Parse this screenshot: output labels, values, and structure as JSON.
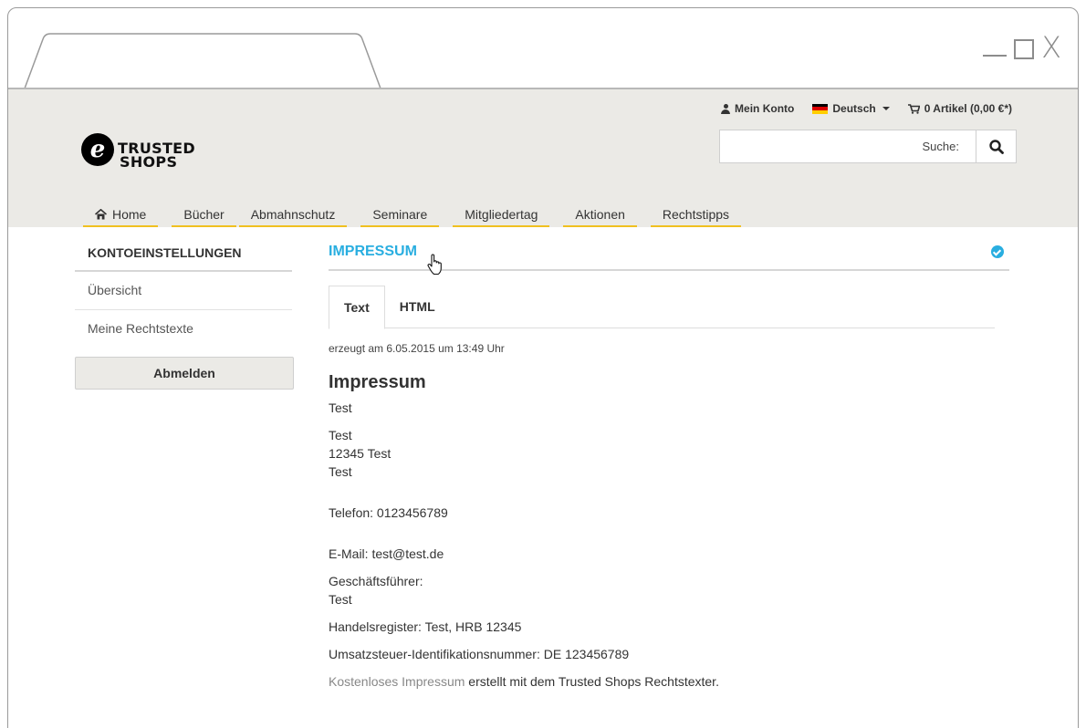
{
  "header": {
    "logo": {
      "mark": "e",
      "line1": "TRUSTED",
      "line2": "SHOPS"
    },
    "topbar": {
      "account": "Mein Konto",
      "language": "Deutsch",
      "cart": "0 Artikel (0,00 €*)"
    },
    "search": {
      "placeholder": "Suche:"
    },
    "nav": [
      "Home",
      "Bücher",
      "Abmahnschutz",
      "Seminare",
      "Mitgliedertag",
      "Aktionen",
      "Rechtstipps"
    ]
  },
  "sidebar": {
    "title": "KONTOEINSTELLUNGEN",
    "links": [
      "Übersicht",
      "Meine Rechtstexte"
    ],
    "logout_label": "Abmelden"
  },
  "main": {
    "title": "IMPRESSUM",
    "tabs": [
      "Text",
      "HTML"
    ],
    "generated": "erzeugt am 6.05.2015 um 13:49 Uhr",
    "content": {
      "heading": "Impressum",
      "company": "Test",
      "address": [
        "Test",
        "12345 Test",
        "Test"
      ],
      "phone": "Telefon: 0123456789",
      "email": "E-Mail: test@test.de",
      "ceo_label": "Geschäftsführer:",
      "ceo_name": "Test",
      "register": "Handelsregister: Test, HRB 12345",
      "vat": "Umsatzsteuer-Identifikationsnummer: DE 123456789",
      "footer_link": "Kostenloses Impressum",
      "footer_text": " erstellt mit dem Trusted Shops Rechtstexter."
    }
  },
  "colors": {
    "accent": "#29aee0",
    "nav_underline": "#f0c020",
    "header_bg": "#ebeae6"
  }
}
